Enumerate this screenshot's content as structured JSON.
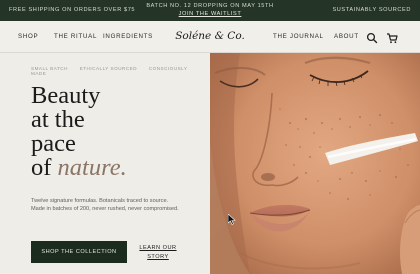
{
  "announcement": {
    "left": "FREE SHIPPING ON ORDERS OVER $75",
    "center": "BATCH NO. 12 DROPPING ON MAY 15TH",
    "center_link": "JOIN THE WAITLIST",
    "right": "SUSTAINABLY SOURCED"
  },
  "nav": {
    "items_left": [
      "SHOP",
      "THE RITUAL",
      "INGREDIENTS"
    ],
    "logo": "Soléne & Co.",
    "items_right": [
      "THE JOURNAL",
      "ABOUT"
    ],
    "icons": [
      "search-icon",
      "cart-icon"
    ]
  },
  "hero": {
    "chips": [
      "SMALL BATCH",
      "ETHICALLY SOURCED",
      "CONSCIOUSLY MADE"
    ],
    "headline_lines": [
      "Beauty",
      "at the",
      "pace"
    ],
    "headline_of": "of",
    "headline_accent": "nature.",
    "copy": "Twelve signature formulas. Botanicals traced to source. Made in batches of 200, never rushed, never compromised.",
    "cta_label": "SHOP THE COLLECTION",
    "secondary_label": "LEARN OUR STORY"
  },
  "colors": {
    "announcement_bg": "#243427",
    "page_bg": "#efede8",
    "cta_bg": "#1b2b1e",
    "accent_text": "#8a7666"
  }
}
